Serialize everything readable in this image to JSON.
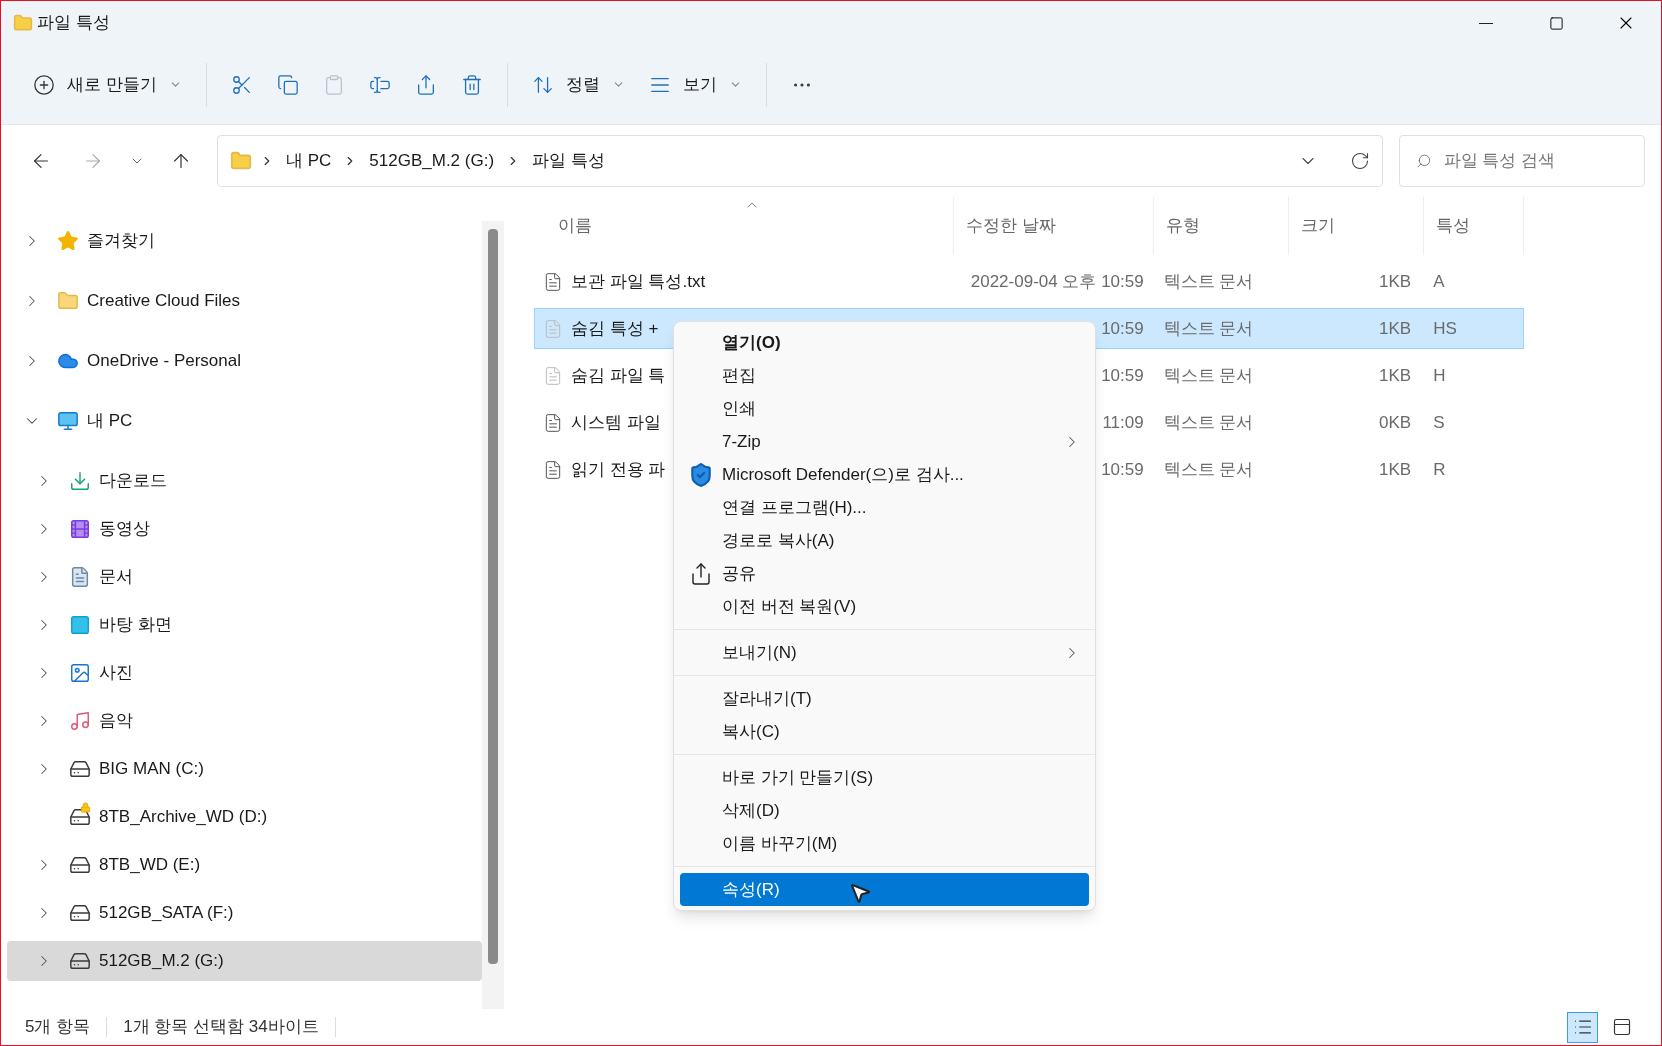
{
  "window": {
    "title": "파일 특성"
  },
  "toolbar": [
    {
      "kind": "new",
      "label": "새로 만들기",
      "disabled": false
    },
    {
      "kind": "cut",
      "disabled": false
    },
    {
      "kind": "copy",
      "disabled": false
    },
    {
      "kind": "paste",
      "disabled": true
    },
    {
      "kind": "rename",
      "disabled": false
    },
    {
      "kind": "share",
      "disabled": false
    },
    {
      "kind": "delete",
      "disabled": false
    },
    {
      "kind": "sort",
      "label": "정렬",
      "disabled": false
    },
    {
      "kind": "view",
      "label": "보기",
      "disabled": false
    },
    {
      "kind": "more",
      "disabled": false
    }
  ],
  "address": {
    "path": [
      "내 PC",
      "512GB_M.2 (G:)",
      "파일 특성"
    ],
    "search_placeholder": "파일 특성 검색"
  },
  "sidebar": [
    {
      "label": "즐겨찾기",
      "kind": "star",
      "expanded": false,
      "selected": false
    },
    {
      "label": "Creative Cloud Files",
      "kind": "cc",
      "expanded": false,
      "selected": false
    },
    {
      "label": "OneDrive - Personal",
      "kind": "cloud",
      "expanded": false,
      "selected": false
    },
    {
      "label": "내 PC",
      "kind": "pc",
      "expanded": true,
      "selected": false,
      "children": [
        {
          "label": "다운로드",
          "kind": "download",
          "expandable": true,
          "selected": false
        },
        {
          "label": "동영상",
          "kind": "video",
          "expandable": true,
          "selected": false
        },
        {
          "label": "문서",
          "kind": "doc",
          "expandable": true,
          "selected": false
        },
        {
          "label": "바탕 화면",
          "kind": "desktop",
          "expandable": true,
          "selected": false
        },
        {
          "label": "사진",
          "kind": "photo",
          "expandable": true,
          "selected": false
        },
        {
          "label": "음악",
          "kind": "music",
          "expandable": true,
          "selected": false
        },
        {
          "label": "BIG MAN (C:)",
          "kind": "system-drive",
          "expandable": true,
          "selected": false
        },
        {
          "label": "8TB_Archive_WD (D:)",
          "kind": "locked-drive",
          "expandable": false,
          "selected": false
        },
        {
          "label": "8TB_WD (E:)",
          "kind": "drive",
          "expandable": true,
          "selected": false
        },
        {
          "label": "512GB_SATA (F:)",
          "kind": "drive",
          "expandable": true,
          "selected": false
        },
        {
          "label": "512GB_M.2 (G:)",
          "kind": "drive",
          "expandable": true,
          "selected": true
        }
      ]
    }
  ],
  "columns": [
    {
      "label": "이름",
      "sorted": true
    },
    {
      "label": "수정한 날짜",
      "sorted": false
    },
    {
      "label": "유형",
      "sorted": false
    },
    {
      "label": "크기",
      "sorted": false
    },
    {
      "label": "특성",
      "sorted": false
    }
  ],
  "rows": [
    {
      "name": "보관 파일 특성.txt",
      "modified": "2022-09-04 오후 10:59",
      "type": "텍스트 문서",
      "size": "1KB",
      "attributes": "A",
      "selected": false,
      "hidden": false
    },
    {
      "name": "숨김 특성 +",
      "modified": "10:59",
      "type": "텍스트 문서",
      "size": "1KB",
      "attributes": "HS",
      "selected": true,
      "hidden": true
    },
    {
      "name": "숨김 파일 특",
      "modified": "10:59",
      "type": "텍스트 문서",
      "size": "1KB",
      "attributes": "H",
      "selected": false,
      "hidden": true
    },
    {
      "name": "시스템 파일",
      "modified": "11:09",
      "type": "텍스트 문서",
      "size": "0KB",
      "attributes": "S",
      "selected": false,
      "hidden": false
    },
    {
      "name": "읽기 전용 파",
      "modified": "10:59",
      "type": "텍스트 문서",
      "size": "1KB",
      "attributes": "R",
      "selected": false,
      "hidden": false
    }
  ],
  "context_menu": {
    "groups": [
      [
        {
          "label": "열기(O)",
          "kind": "plain",
          "bold": true,
          "submenu": false,
          "selected": false
        },
        {
          "label": "편집",
          "kind": "plain",
          "bold": false,
          "submenu": false,
          "selected": false
        },
        {
          "label": "인쇄",
          "kind": "plain",
          "bold": false,
          "submenu": false,
          "selected": false
        },
        {
          "label": "7-Zip",
          "kind": "plain",
          "bold": false,
          "submenu": true,
          "selected": false
        },
        {
          "label": "Microsoft Defender(으)로 검사...",
          "kind": "shield",
          "bold": false,
          "submenu": false,
          "selected": false
        },
        {
          "label": "연결 프로그램(H)...",
          "kind": "plain",
          "bold": false,
          "submenu": false,
          "selected": false
        },
        {
          "label": "경로로 복사(A)",
          "kind": "plain",
          "bold": false,
          "submenu": false,
          "selected": false
        },
        {
          "label": "공유",
          "kind": "share",
          "bold": false,
          "submenu": false,
          "selected": false
        },
        {
          "label": "이전 버전 복원(V)",
          "kind": "plain",
          "bold": false,
          "submenu": false,
          "selected": false
        }
      ],
      [
        {
          "label": "보내기(N)",
          "kind": "plain",
          "bold": false,
          "submenu": true,
          "selected": false
        }
      ],
      [
        {
          "label": "잘라내기(T)",
          "kind": "plain",
          "bold": false,
          "submenu": false,
          "selected": false
        },
        {
          "label": "복사(C)",
          "kind": "plain",
          "bold": false,
          "submenu": false,
          "selected": false
        }
      ],
      [
        {
          "label": "바로 가기 만들기(S)",
          "kind": "plain",
          "bold": false,
          "submenu": false,
          "selected": false
        },
        {
          "label": "삭제(D)",
          "kind": "plain",
          "bold": false,
          "submenu": false,
          "selected": false
        },
        {
          "label": "이름 바꾸기(M)",
          "kind": "plain",
          "bold": false,
          "submenu": false,
          "selected": false
        }
      ],
      [
        {
          "label": "속성(R)",
          "kind": "plain",
          "bold": false,
          "submenu": false,
          "selected": true
        }
      ]
    ]
  },
  "status_bar": {
    "count": "5개 항목",
    "selection": "1개 항목 선택함 34바이트",
    "views": [
      {
        "kind": "details",
        "selected": true
      },
      {
        "kind": "tiles",
        "selected": false
      }
    ]
  }
}
